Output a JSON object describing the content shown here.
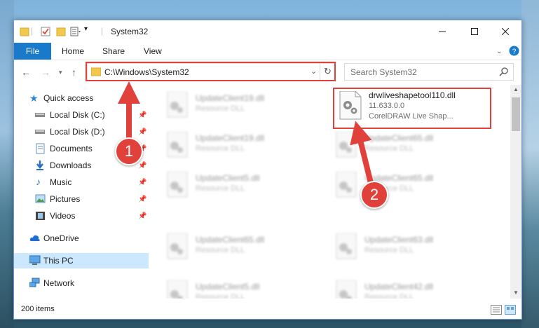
{
  "window": {
    "title": "System32"
  },
  "ribbon": {
    "tabs": [
      "File",
      "Home",
      "Share",
      "View"
    ]
  },
  "address": {
    "path": "C:\\Windows\\System32"
  },
  "search": {
    "placeholder": "Search System32"
  },
  "sidebar": {
    "items": [
      {
        "label": "Quick access",
        "icon": "star-icon"
      },
      {
        "label": "Local Disk (C:)",
        "icon": "drive-icon",
        "pinned": true
      },
      {
        "label": "Local Disk (D:)",
        "icon": "drive-icon",
        "pinned": true
      },
      {
        "label": "Documents",
        "icon": "documents-icon",
        "pinned": true
      },
      {
        "label": "Downloads",
        "icon": "downloads-icon",
        "pinned": true
      },
      {
        "label": "Music",
        "icon": "music-icon",
        "pinned": true
      },
      {
        "label": "Pictures",
        "icon": "pictures-icon",
        "pinned": true
      },
      {
        "label": "Videos",
        "icon": "videos-icon",
        "pinned": true
      },
      {
        "label": "OneDrive",
        "icon": "cloud-icon"
      },
      {
        "label": "This PC",
        "icon": "computer-icon",
        "selected": true
      },
      {
        "label": "Network",
        "icon": "network-icon"
      }
    ]
  },
  "files": [
    {
      "name": "UpdateClient19.dll",
      "desc": "Resource DLL"
    },
    {
      "name": "UpdateClient19.dll",
      "desc": "Resource DLL"
    },
    {
      "name": "UpdateClient5.dll",
      "desc": "Resource DLL"
    },
    {
      "name": "UpdateClient65.dll",
      "desc": "Resource DLL"
    },
    {
      "name": "UpdateClient5.dll",
      "desc": "Resource DLL"
    },
    {
      "name": "UpdateClient65.dll",
      "desc": "Resource DLL"
    },
    {
      "name": "UpdateClient65.dll",
      "desc": "Resource DLL"
    },
    {
      "name": "UpdateClient63.dll",
      "desc": "Resource DLL"
    },
    {
      "name": "UpdateClient42.dll",
      "desc": "Resource DLL"
    }
  ],
  "highlighted_file": {
    "name": "drwliveshapetool110.dll",
    "version": "11.633.0.0",
    "description": "CorelDRAW Live Shap..."
  },
  "status": {
    "item_count": "200 items"
  },
  "callouts": [
    "1",
    "2"
  ],
  "colors": {
    "accent": "#1979ca",
    "callout": "#e0413a",
    "selection": "#cce8ff"
  }
}
